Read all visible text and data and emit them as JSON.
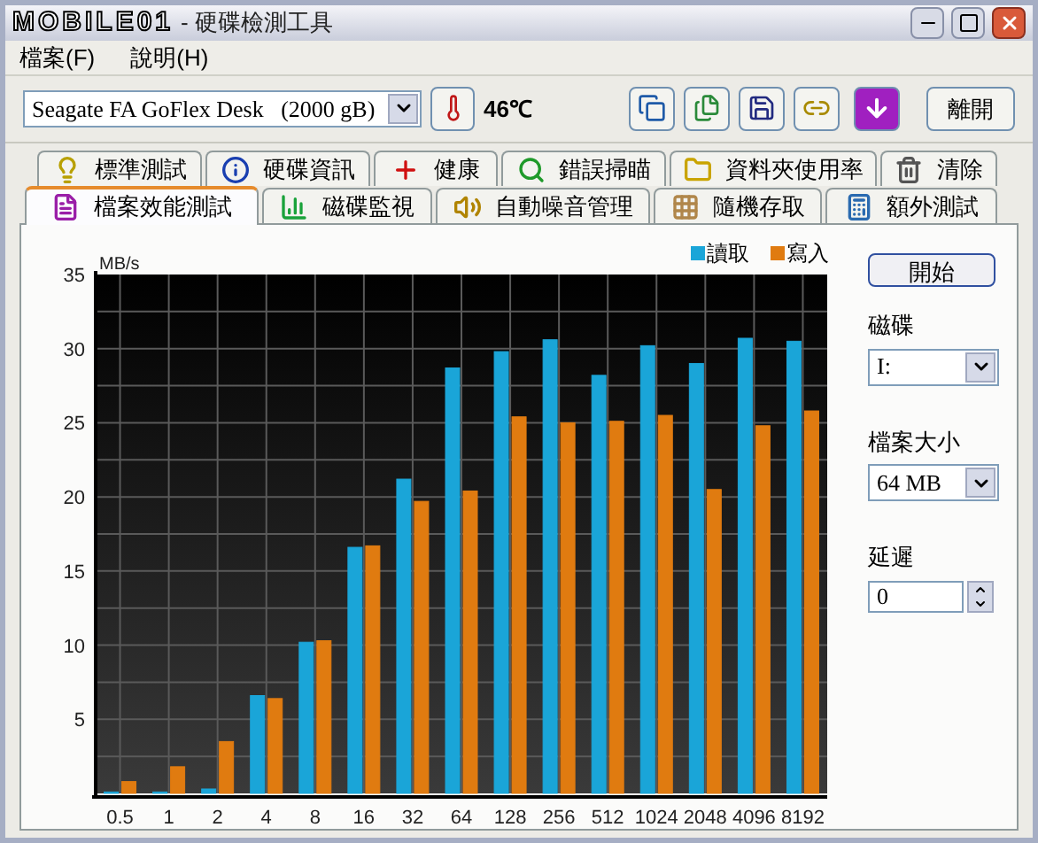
{
  "window": {
    "logo": "MOBILE01",
    "title": "- 硬碟檢測工具"
  },
  "menu": [
    {
      "label": "檔案(F)"
    },
    {
      "label": "說明(H)"
    }
  ],
  "toolbar": {
    "drive": "Seagate FA GoFlex Desk   (2000 gB)",
    "temperature": "46℃",
    "exit_button": "離開"
  },
  "tabs_back": [
    {
      "label": "標準測試",
      "selected": false
    },
    {
      "label": "硬碟資訊",
      "selected": false
    },
    {
      "label": "健康",
      "selected": false
    },
    {
      "label": "錯誤掃瞄",
      "selected": false
    },
    {
      "label": "資料夾使用率",
      "selected": false
    },
    {
      "label": "清除",
      "selected": false
    }
  ],
  "tabs_front": [
    {
      "label": "檔案效能測試",
      "selected": true
    },
    {
      "label": "磁碟監視",
      "selected": false
    },
    {
      "label": "自動噪音管理",
      "selected": false
    },
    {
      "label": "隨機存取",
      "selected": false
    },
    {
      "label": "額外測試",
      "selected": false
    }
  ],
  "chart": {
    "chart_data": {
      "type": "bar",
      "ylabel": "MB/s",
      "categories": [
        "0.5",
        "1",
        "2",
        "4",
        "8",
        "16",
        "32",
        "64",
        "128",
        "256",
        "512",
        "1024",
        "2048",
        "4096",
        "8192"
      ],
      "ylim": [
        0,
        35
      ],
      "grid": true,
      "legend": "top-right",
      "yticks": [
        5,
        10,
        15,
        20,
        25,
        30,
        35
      ],
      "series": [
        {
          "name": "讀取",
          "color": "#1aa5d8",
          "values": [
            0.1,
            0.1,
            0.3,
            6.6,
            10.2,
            16.6,
            21.2,
            28.7,
            29.8,
            30.6,
            28.2,
            30.2,
            29.0,
            30.7,
            30.5
          ]
        },
        {
          "name": "寫入",
          "color": "#e07b10",
          "values": [
            0.8,
            1.8,
            3.5,
            6.4,
            10.3,
            16.7,
            19.7,
            20.4,
            25.4,
            25.0,
            25.1,
            25.5,
            20.5,
            24.8,
            25.8
          ]
        }
      ]
    }
  },
  "controls": {
    "start_button": "開始",
    "disk_label": "磁碟",
    "disk_value": "I:",
    "file_size_label": "檔案大小",
    "file_size_value": "64 MB",
    "delay_label": "延遲",
    "delay_value": "0"
  }
}
